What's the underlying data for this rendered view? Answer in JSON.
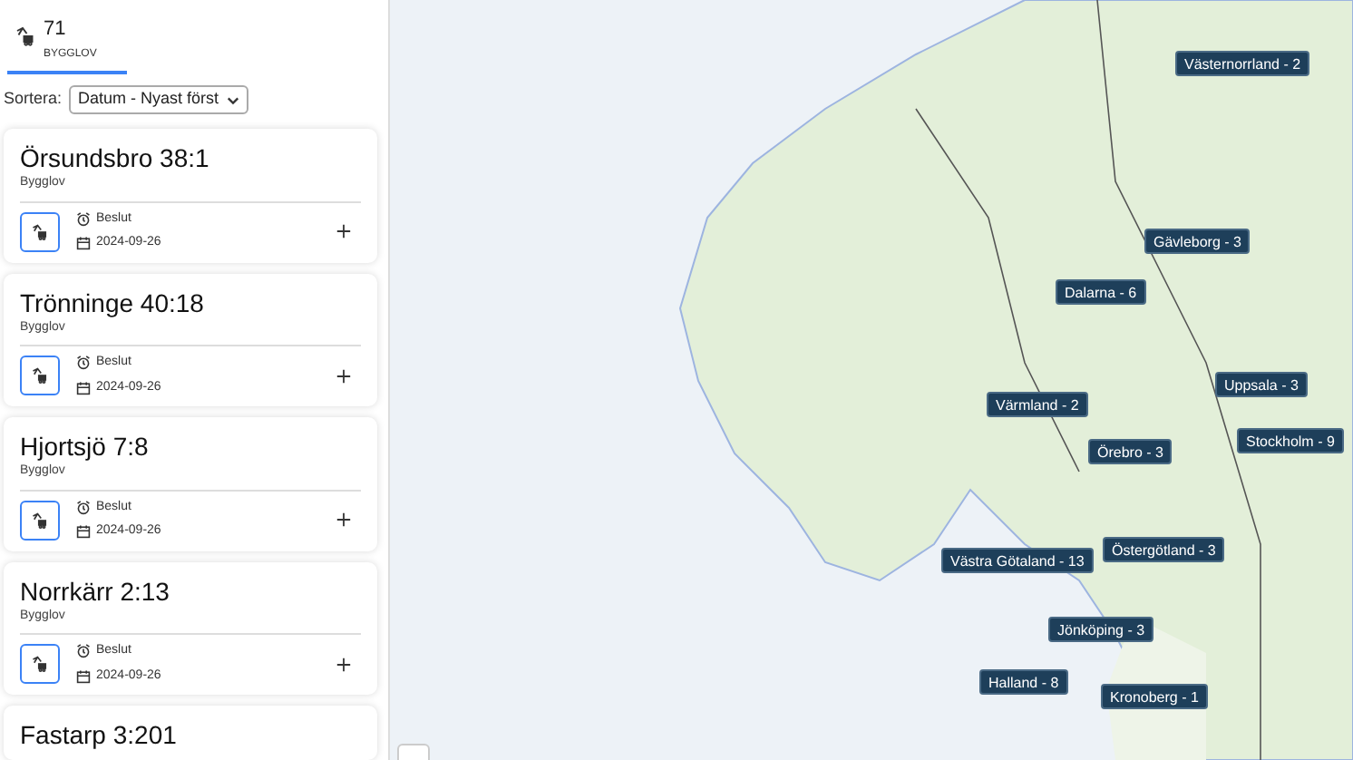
{
  "tabs": [
    {
      "count": "71",
      "label": "BYGGLOV",
      "selected": true
    }
  ],
  "sort": {
    "label": "Sortera:",
    "value": "Datum - Nyast först"
  },
  "cards": [
    {
      "title": "Örsundsbro 38:1",
      "type": "Bygglov",
      "status": "Beslut",
      "date": "2024-09-26"
    },
    {
      "title": "Trönninge 40:18",
      "type": "Bygglov",
      "status": "Beslut",
      "date": "2024-09-26"
    },
    {
      "title": "Hjortsjö 7:8",
      "type": "Bygglov",
      "status": "Beslut",
      "date": "2024-09-26"
    },
    {
      "title": "Norrkärr 2:13",
      "type": "Bygglov",
      "status": "Beslut",
      "date": "2024-09-26"
    },
    {
      "title": "Fastarp 3:201"
    }
  ],
  "map": {
    "markers": [
      "Västernorrland - 2",
      "Gävleborg - 3",
      "Dalarna - 6",
      "Värmland - 2",
      "Uppsala - 3",
      "Stockholm - 9",
      "Örebro - 3",
      "Västra Götaland - 13",
      "Östergötland - 3",
      "Jönköping - 3",
      "Halland - 8",
      "Kronoberg - 1"
    ]
  }
}
